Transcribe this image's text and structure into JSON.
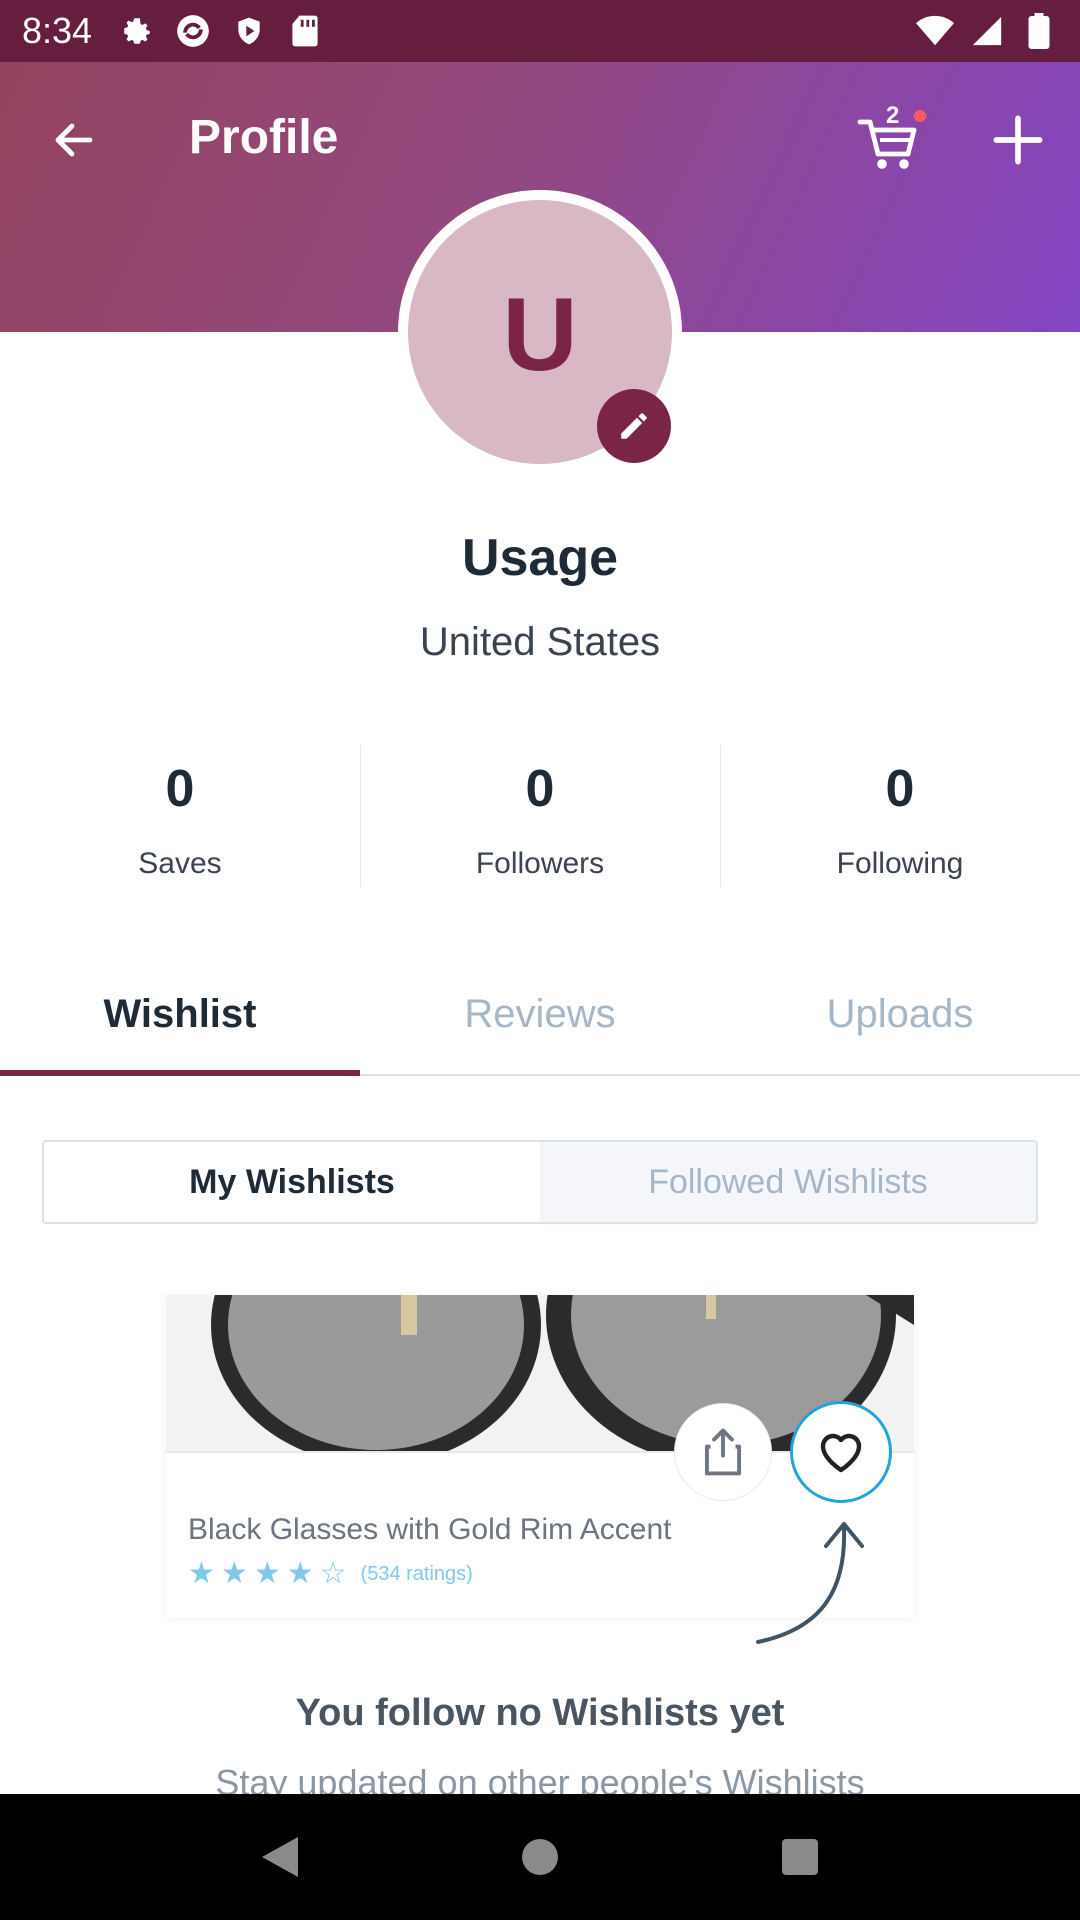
{
  "status_bar": {
    "time": "8:34",
    "left_icons": [
      "settings-icon",
      "sync-icon",
      "shield-icon",
      "sd-card-icon"
    ],
    "right_icons": [
      "wifi-icon",
      "signal-icon",
      "battery-icon"
    ]
  },
  "header": {
    "title": "Profile",
    "cart_count": "2",
    "gradient": [
      "#95435f",
      "#8445c4"
    ]
  },
  "profile": {
    "avatar_letter": "U",
    "name": "Usage",
    "location": "United States"
  },
  "stats": [
    {
      "value": "0",
      "label": "Saves"
    },
    {
      "value": "0",
      "label": "Followers"
    },
    {
      "value": "0",
      "label": "Following"
    }
  ],
  "tabs": [
    {
      "label": "Wishlist",
      "active": true
    },
    {
      "label": "Reviews",
      "active": false
    },
    {
      "label": "Uploads",
      "active": false
    }
  ],
  "segmented": {
    "my_wishlists": "My Wishlists",
    "followed_wishlists": "Followed Wishlists",
    "selected": "My Wishlists"
  },
  "illustration": {
    "product_title": "Black Glasses with Gold Rim Accent",
    "rating_stars": 4,
    "rating_max": 5,
    "ratings_text": "(534 ratings)"
  },
  "empty_state": {
    "title": "You follow no Wishlists yet",
    "subtitle": "Stay updated on other people's Wishlists"
  },
  "colors": {
    "accent": "#7a2548",
    "status_bar": "#651e3e",
    "heart_ring": "#1fa5d9",
    "stars": "#7fc9ee"
  }
}
